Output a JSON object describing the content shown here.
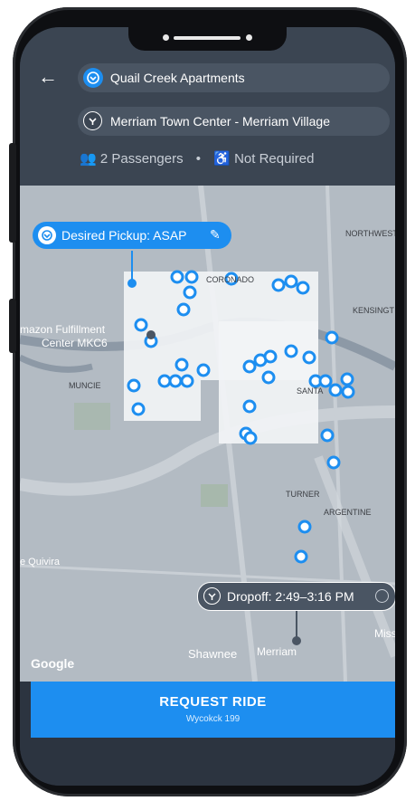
{
  "header": {
    "pickup_location": "Quail Creek Apartments",
    "dropoff_location": "Merriam Town Center - Merriam Village",
    "passengers": "2 Passengers",
    "separator": "•",
    "accessibility": "Not Required"
  },
  "map": {
    "desired_pickup": "Desired Pickup: ASAP",
    "dropoff_window": "Dropoff: 2:49–3:16 PM",
    "labels": {
      "northwest": "NORTHWEST",
      "kensington": "KENSINGT",
      "amazon": "mazon Fulfillment",
      "amazon2": "Center MKC6",
      "muncie": "MUNCIE",
      "santa": "SANTA",
      "turner": "TURNER",
      "argentine": "ARGENTINE",
      "quivira": "e Quivira",
      "shawnee": "Shawnee",
      "merriam": "Merriam",
      "mission": "Missi",
      "google": "Google",
      "coronado": "CORONADO"
    }
  },
  "request": {
    "label": "REQUEST RIDE",
    "sublabel": "Wycokck 199"
  },
  "colors": {
    "accent": "#1d8ef0",
    "header_bg": "#3b4552"
  }
}
